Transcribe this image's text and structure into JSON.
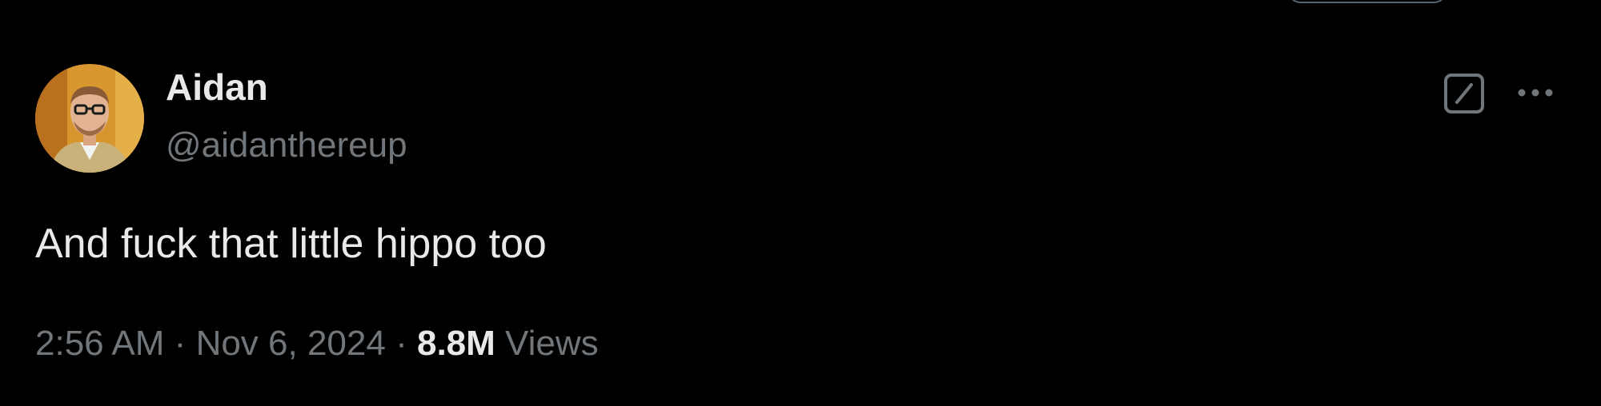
{
  "tweet": {
    "author": {
      "display_name": "Aidan",
      "handle": "@aidanthereup"
    },
    "text": "And fuck that little hippo too",
    "time": "2:56 AM",
    "separator": "·",
    "date": "Nov 6, 2024",
    "views_count": "8.8M",
    "views_label": "Views"
  },
  "icons": {
    "grok": "grok-icon",
    "more": "more-icon"
  },
  "colors": {
    "background": "#000000",
    "primary_text": "#e7e9ea",
    "secondary_text": "#71767b"
  }
}
